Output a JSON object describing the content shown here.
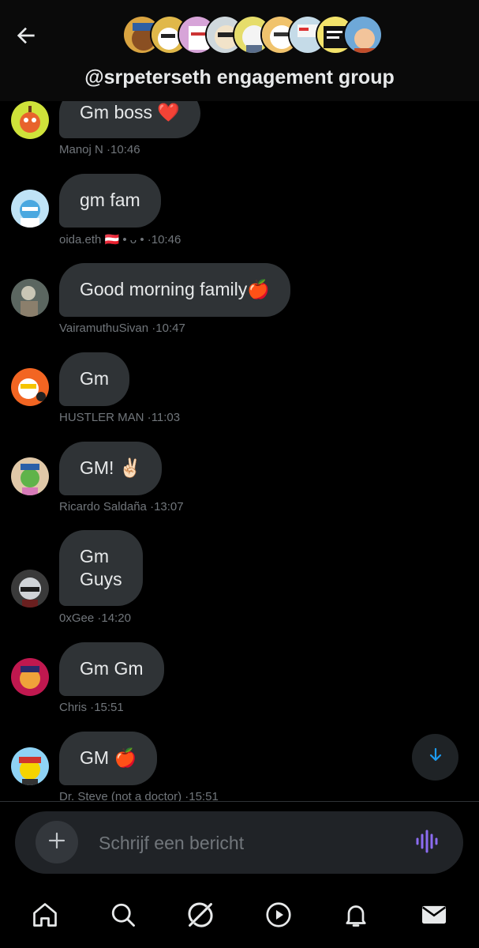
{
  "header": {
    "title": "@srpeterseth engagement group",
    "stack_avatar_colors": [
      "#d9a441",
      "#e0b84a",
      "#d7a4d8",
      "#cfd8dc",
      "#e6dd6b",
      "#f0c36d",
      "#c5dbe8",
      "#f3e36b",
      "#6ea8d8"
    ]
  },
  "messages": [
    {
      "text": "Gm boss ❤️",
      "author": "Manoj N",
      "time": "10:46",
      "avatar_bg": "#cfe23a",
      "avatar_fg": "#e8632c"
    },
    {
      "text": "gm fam",
      "author": "oida.eth 🇦🇹 • ᴗ •",
      "time": "10:46",
      "avatar_bg": "#bfe3f6",
      "avatar_fg": "#4aa8e0"
    },
    {
      "text": "Good morning family🍎",
      "author": "VairamuthuSivan",
      "time": "10:47",
      "avatar_bg": "#5b6660",
      "avatar_fg": "#c9c6b5"
    },
    {
      "text": "Gm",
      "author": "HUSTLER MAN",
      "time": "11:03",
      "avatar_bg": "#f26522",
      "avatar_fg": "#ffffff"
    },
    {
      "text": "GM! ✌🏻",
      "author": "Ricardo Saldaña",
      "time": "13:07",
      "avatar_bg": "#e0c8a8",
      "avatar_fg": "#5fb34a"
    },
    {
      "text": "Gm\nGuys",
      "author": "0xGee",
      "time": "14:20",
      "avatar_bg": "#3a3a3a",
      "avatar_fg": "#d0d4d8"
    },
    {
      "text": "Gm Gm",
      "author": "Chris",
      "time": "15:51",
      "avatar_bg": "#c0184f",
      "avatar_fg": "#f0a23a"
    },
    {
      "text": "GM 🍎",
      "author": "Dr. Steve (not a doctor)",
      "time": "15:51",
      "avatar_bg": "#8fd3f5",
      "avatar_fg": "#f5d400"
    }
  ],
  "composer": {
    "placeholder": "Schrijf een bericht"
  },
  "nav": [
    "home-icon",
    "search-icon",
    "grok-icon",
    "play-icon",
    "bell-icon",
    "mail-icon"
  ],
  "colors": {
    "bubble": "#2f3336",
    "muted": "#71767b",
    "accent": "#1d9bf0",
    "voice": "#8c6cf2"
  }
}
